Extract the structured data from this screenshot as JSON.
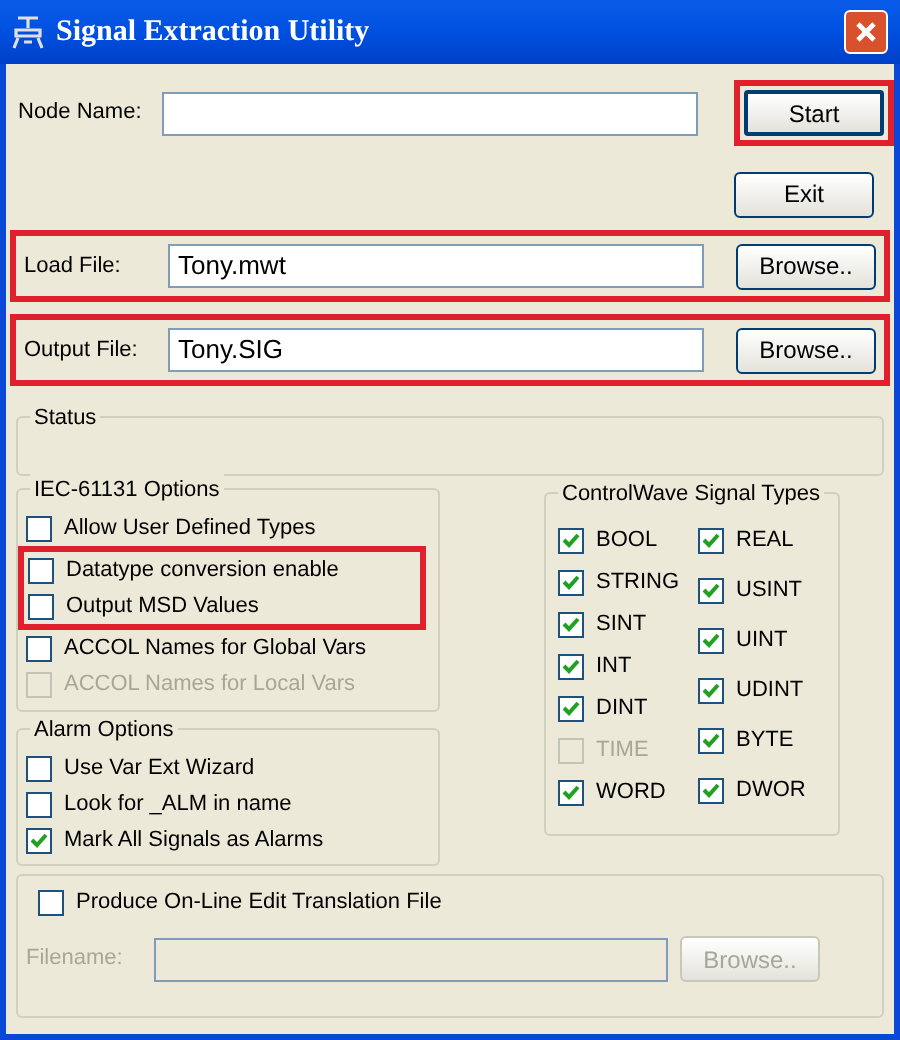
{
  "window": {
    "title": "Signal Extraction Utility"
  },
  "node_name": {
    "label": "Node Name:"
  },
  "start_button": {
    "label": "Start",
    "highlighted": true
  },
  "exit_button": {
    "label": "Exit",
    "highlighted": false
  },
  "file_rows": [
    {
      "label": "Load File:",
      "value": "Tony.mwt",
      "button": "Browse..",
      "highlighted": true
    },
    {
      "label": "Output File:",
      "value": "Tony.SIG",
      "button": "Browse..",
      "highlighted": true
    }
  ],
  "status": {
    "title": "Status"
  },
  "iec_options": {
    "title": "IEC-61131 Options",
    "items": [
      {
        "label": "Allow User Defined Types",
        "checked": false,
        "disabled": false,
        "highlighted": false
      },
      {
        "label": "Datatype conversion enable",
        "checked": false,
        "disabled": false,
        "highlighted": true
      },
      {
        "label": "Output MSD Values",
        "checked": false,
        "disabled": false,
        "highlighted": true
      },
      {
        "label": "ACCOL Names for Global Vars",
        "checked": false,
        "disabled": false,
        "highlighted": false
      },
      {
        "label": "ACCOL Names for Local Vars",
        "checked": false,
        "disabled": true,
        "highlighted": false
      }
    ]
  },
  "alarm_options": {
    "title": "Alarm Options",
    "items": [
      {
        "label": "Use Var Ext Wizard",
        "checked": false,
        "disabled": false
      },
      {
        "label": "Look for _ALM in name",
        "checked": false,
        "disabled": false
      },
      {
        "label": "Mark All Signals as Alarms",
        "checked": true,
        "disabled": false
      }
    ]
  },
  "signal_types": {
    "title": "ControlWave Signal Types",
    "columns": [
      [
        {
          "label": "BOOL",
          "checked": true,
          "disabled": false
        },
        {
          "label": "STRING",
          "checked": true,
          "disabled": false
        },
        {
          "label": "SINT",
          "checked": true,
          "disabled": false
        },
        {
          "label": "INT",
          "checked": true,
          "disabled": false
        },
        {
          "label": "DINT",
          "checked": true,
          "disabled": false
        },
        {
          "label": "TIME",
          "checked": false,
          "disabled": true
        },
        {
          "label": "WORD",
          "checked": true,
          "disabled": false
        }
      ],
      [
        {
          "label": "REAL",
          "checked": true,
          "disabled": false
        },
        {
          "label": "USINT",
          "checked": true,
          "disabled": false
        },
        {
          "label": "UINT",
          "checked": true,
          "disabled": false
        },
        {
          "label": "UDINT",
          "checked": true,
          "disabled": false
        },
        {
          "label": "BYTE",
          "checked": true,
          "disabled": false
        },
        {
          "label": "DWOR",
          "checked": true,
          "disabled": false
        }
      ]
    ]
  },
  "online_edit": {
    "label": "Produce On-Line Edit Translation File",
    "checked": false,
    "filename_label": "Filename:",
    "browse_button": "Browse..",
    "disabled": true
  }
}
